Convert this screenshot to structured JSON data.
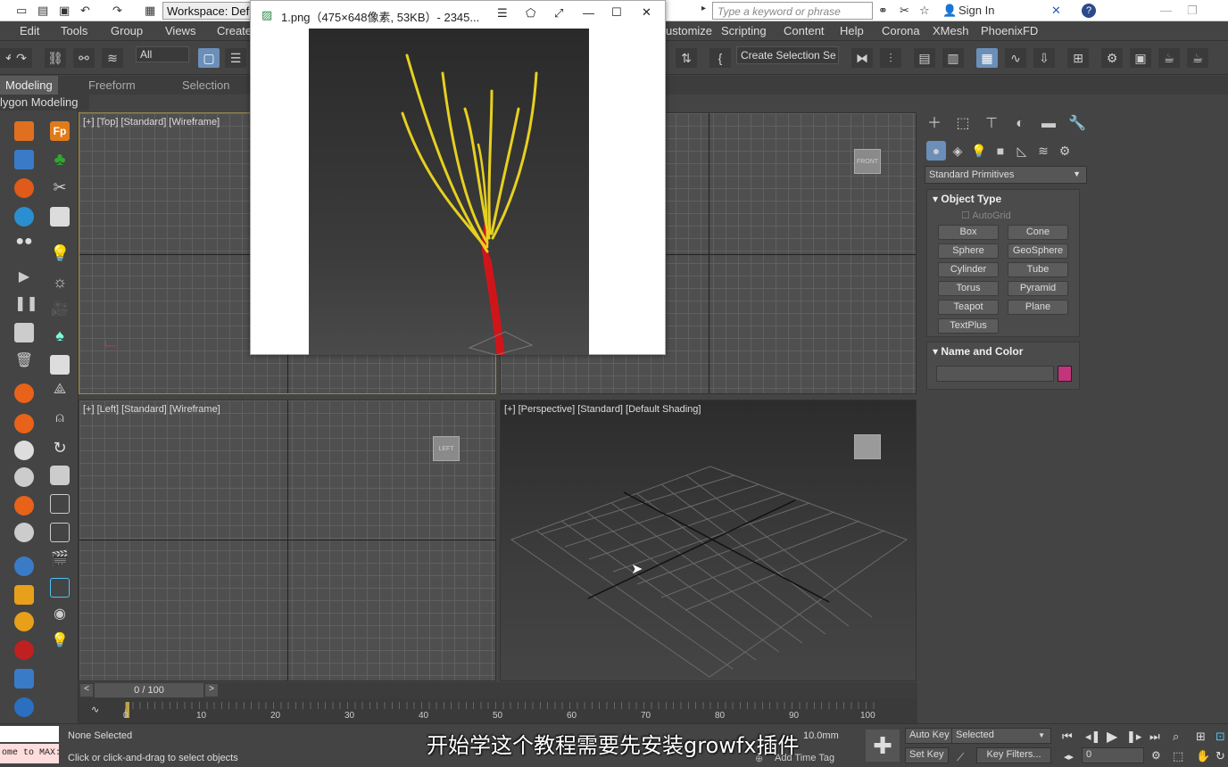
{
  "titlebar": {
    "workspace_label": "Workspace: Def",
    "search_placeholder": "Type a keyword or phrase",
    "sign_in": "Sign In",
    "help": "?"
  },
  "menu": [
    "Edit",
    "Tools",
    "Group",
    "Views",
    "Create",
    "ustomize",
    "Scripting",
    "Content",
    "Help",
    "Corona",
    "XMesh",
    "PhoenixFD"
  ],
  "toolbar": {
    "filter_value": "All",
    "selection_set": "Create Selection Se"
  },
  "ribbon": {
    "tabs": [
      "Modeling",
      "Freeform",
      "Selection"
    ],
    "active_tab": "Modeling",
    "panel_label": "lygon Modeling"
  },
  "viewports": {
    "top": "[+] [Top] [Standard] [Wireframe]",
    "front_tag": "]",
    "left": "[+] [Left] [Standard] [Wireframe]",
    "perspective": "[+] [Perspective] [Standard] [Default Shading]",
    "front_cube": "FRONT",
    "left_cube": "LEFT"
  },
  "image_viewer": {
    "title": "1.png（475×648像素, 53KB）- 2345..."
  },
  "command_panel": {
    "category": "Standard Primitives",
    "object_type_title": "Object Type",
    "autogrid": "AutoGrid",
    "buttons": [
      "Box",
      "Cone",
      "Sphere",
      "GeoSphere",
      "Cylinder",
      "Tube",
      "Torus",
      "Pyramid",
      "Teapot",
      "Plane",
      "TextPlus"
    ],
    "name_color_title": "Name and Color",
    "color_swatch": "#c2357a"
  },
  "timeline": {
    "frame_counter": "0 / 100",
    "ticks": [
      "0",
      "10",
      "20",
      "30",
      "40",
      "50",
      "60",
      "70",
      "80",
      "90",
      "100"
    ]
  },
  "status": {
    "maxscript": "ome to MAX:",
    "selection": "None Selected",
    "hint": "Click or click-and-drag to select objects",
    "grid": "10.0mm",
    "add_time_tag": "Add Time Tag",
    "auto_key": "Auto Key",
    "set_key": "Set Key",
    "key_mode": "Selected",
    "key_filters": "Key Filters...",
    "frame": "0"
  },
  "subtitle": "开始学这个教程需要先安装growfx插件"
}
